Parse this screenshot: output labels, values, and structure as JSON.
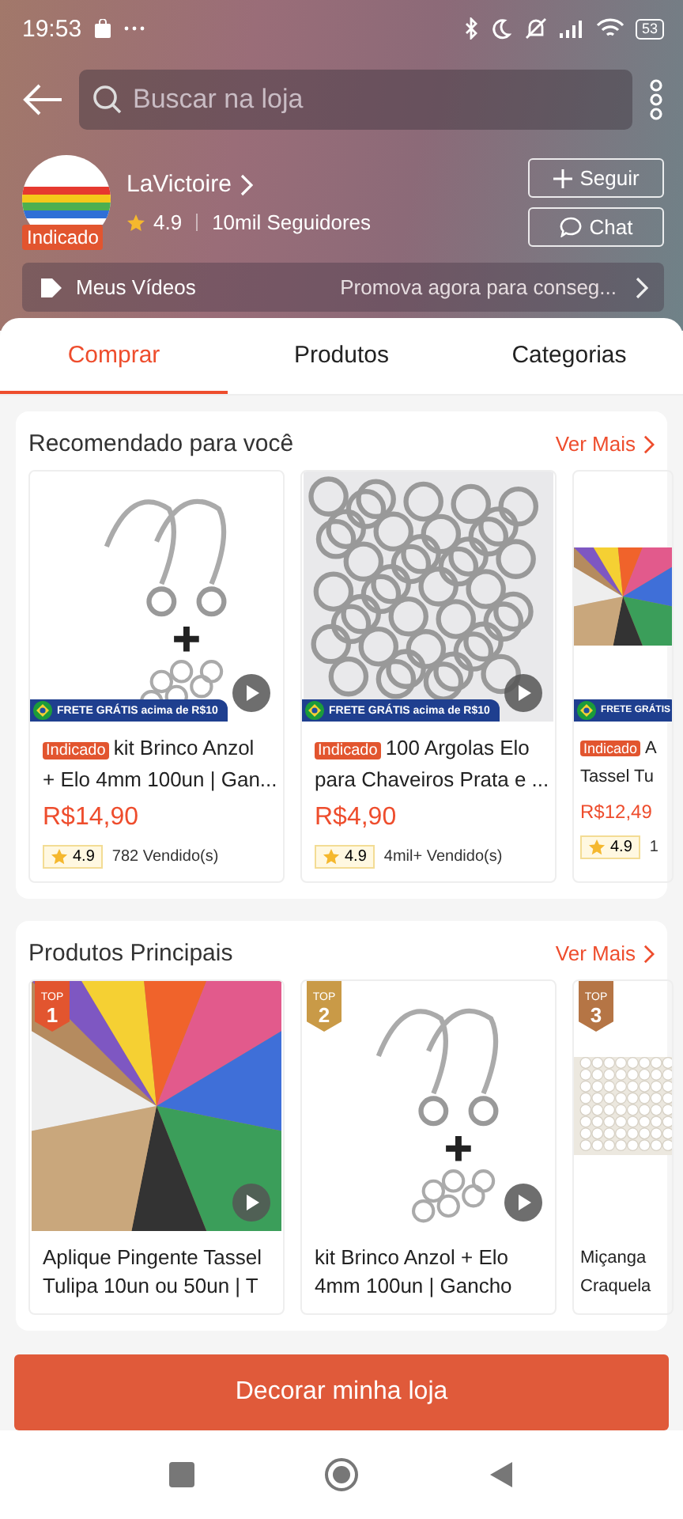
{
  "status_bar": {
    "time": "19:53",
    "battery": "53"
  },
  "header": {
    "search": {
      "placeholder": "Buscar na loja"
    },
    "shop": {
      "name": "LaVictoire",
      "badge": "Indicado",
      "rating": "4.9",
      "followers": "10mil Seguidores"
    },
    "buttons": [
      {
        "kind": "follow",
        "label": "Seguir"
      },
      {
        "kind": "chat",
        "label": "Chat"
      }
    ],
    "videos": {
      "label": "Meus Vídeos",
      "promo": "Promova agora para conseg..."
    }
  },
  "tabs": [
    {
      "label": "Comprar",
      "selected": true
    },
    {
      "label": "Produtos",
      "selected": false
    },
    {
      "label": "Categorias",
      "selected": false
    }
  ],
  "sections": [
    {
      "title": "Recomendado para você",
      "link": "Ver Mais",
      "products": [
        {
          "video": true,
          "frete": "FRETE GRÁTIS acima de R$10",
          "tag": "Indicado",
          "title_lines": [
            "kit Brinco Anzol",
            "+ Elo 4mm 100un | Gan..."
          ],
          "price": "R$14,90",
          "rating": "4.9",
          "sold": "782 Vendido(s)"
        },
        {
          "video": true,
          "frete": "FRETE GRÁTIS acima de R$10",
          "tag": "Indicado",
          "title_lines": [
            "100 Argolas Elo",
            "para Chaveiros Prata e ..."
          ],
          "price": "R$4,90",
          "rating": "4.9",
          "sold": "4mil+ Vendido(s)"
        },
        {
          "video": false,
          "frete": "FRETE GRÁTIS",
          "tag": "Indicado",
          "title_lines": [
            "A",
            "Tassel Tu"
          ],
          "price": "R$12,49",
          "rating": "4.9",
          "sold": "1"
        }
      ]
    },
    {
      "title": "Produtos Principais",
      "link": "Ver Mais",
      "products": [
        {
          "video": true,
          "rank_label": "TOP",
          "rank": "1",
          "title_lines": [
            "Aplique Pingente Tassel",
            "Tulipa 10un ou 50un | T"
          ]
        },
        {
          "video": true,
          "rank_label": "TOP",
          "rank": "2",
          "title_lines": [
            "kit Brinco Anzol + Elo",
            "4mm 100un | Gancho"
          ]
        },
        {
          "video": false,
          "rank_label": "TOP",
          "rank": "3",
          "title_lines": [
            "Miçanga",
            "Craquela"
          ]
        }
      ]
    }
  ],
  "bottom_button": {
    "label": "Decorar minha loja"
  }
}
